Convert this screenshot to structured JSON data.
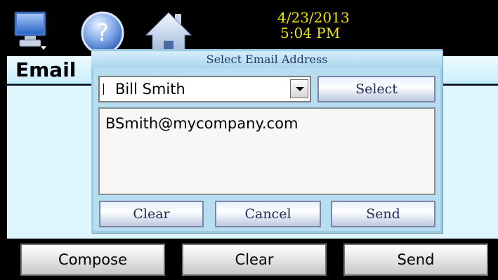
{
  "topbar": {
    "date": "4/23/2013",
    "time": "5:04 PM",
    "icons": [
      "monitor-icon",
      "help-icon",
      "home-icon"
    ]
  },
  "screen": {
    "title": "Email"
  },
  "dialog": {
    "title": "Select Email Address",
    "selected_contact": "Bill Smith",
    "select_label": "Select",
    "email": "BSmith@mycompany.com",
    "clear_label": "Clear",
    "cancel_label": "Cancel",
    "send_label": "Send"
  },
  "bottom": {
    "compose_label": "Compose",
    "clear_label": "Clear",
    "send_label": "Send"
  },
  "colors": {
    "datetime": "#f1e400",
    "header_blue": "#cbeefb",
    "dialog_blue": "#b6ddf0"
  }
}
